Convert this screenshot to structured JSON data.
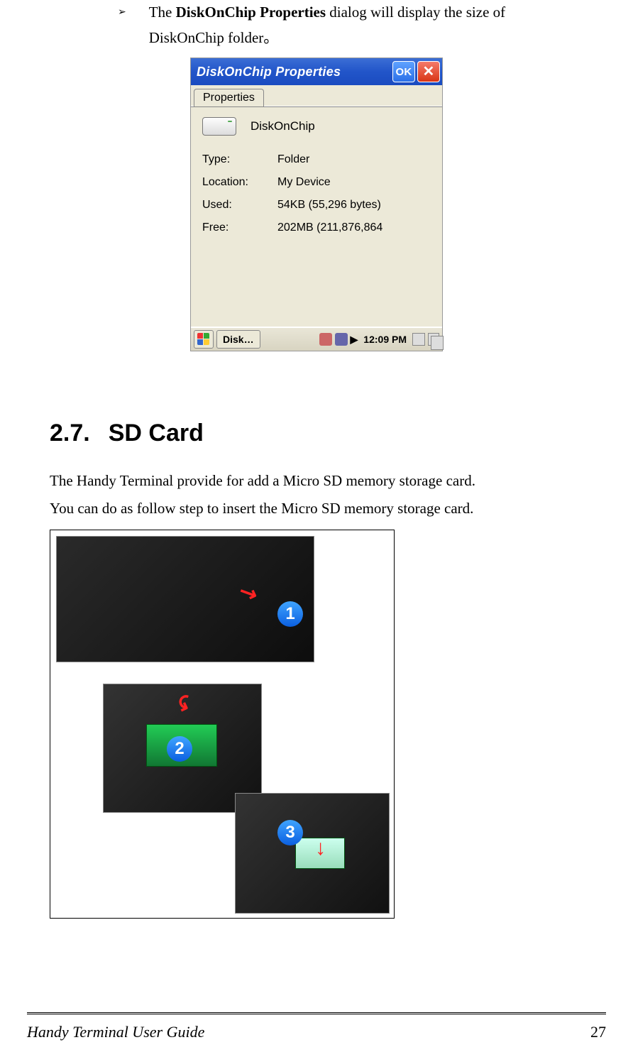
{
  "bullet": {
    "symbol": "➢",
    "text_pre": "The ",
    "text_bold": "DiskOnChip Properties",
    "text_post": " dialog will display the size of DiskOnChip folder。"
  },
  "dialog": {
    "title": "DiskOnChip Properties",
    "ok": "OK",
    "close": "✕",
    "tab": "Properties",
    "object_name": "DiskOnChip",
    "rows": {
      "type": {
        "label": "Type:",
        "value": "Folder"
      },
      "location": {
        "label": "Location:",
        "value": "My Device"
      },
      "used": {
        "label": "Used:",
        "value": "54KB (55,296 bytes)"
      },
      "free": {
        "label": "Free:",
        "value": "202MB (211,876,864"
      }
    },
    "taskbar": {
      "task": "Disk…",
      "time": "12:09 PM"
    }
  },
  "section": {
    "number": "2.7.",
    "title": "SD Card"
  },
  "body": {
    "line1": "The Handy Terminal provide for add a Micro SD memory storage card.",
    "line2": "You can do as follow step to insert the Micro SD memory storage card."
  },
  "markers": {
    "m1": "1",
    "m2": "2",
    "m3": "3"
  },
  "footer": {
    "title": "Handy Terminal User Guide",
    "page": "27"
  }
}
